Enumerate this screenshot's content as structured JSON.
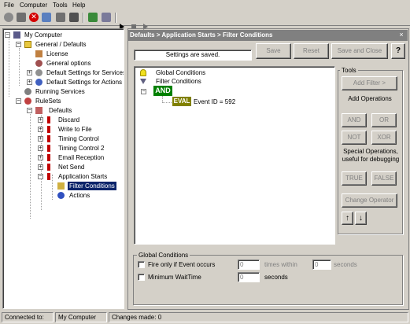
{
  "menu": [
    "File",
    "Computer",
    "Tools",
    "Help"
  ],
  "toolbar": {
    "icons": [
      "settings-gear-icon",
      "save-icon",
      "delete-icon",
      "connect-icon",
      "tools-icon",
      "stop-square-icon",
      "refresh-icon",
      "export-icon",
      "play-icon",
      "stop-icon",
      "step-icon"
    ]
  },
  "tree": {
    "root": "My Computer",
    "general_defaults": "General / Defaults",
    "license": "License",
    "general_options": "General options",
    "default_services": "Default Settings for Services",
    "default_actions": "Default Settings for Actions",
    "running_services": "Running Services",
    "rulesets": "RuleSets",
    "defaults": "Defaults",
    "rules": [
      "Discard",
      "Write to File",
      "Timing Control",
      "Timing Control 2",
      "Email Reception",
      "Net Send",
      "Application Starts"
    ],
    "filter_conditions": "Filter Conditions",
    "actions": "Actions"
  },
  "panel": {
    "breadcrumb": "Defaults > Application Starts > Filter Conditions",
    "close": "×",
    "status_message": "Settings are saved.",
    "save": "Save",
    "reset": "Reset",
    "save_close": "Save and Close",
    "help": "?"
  },
  "filters": {
    "global_conditions": "Global Conditions",
    "filter_conditions": "Filter Conditions",
    "and": "AND",
    "eval": "EVAL",
    "event_id": "Event ID = 592"
  },
  "tools": {
    "title": "Tools",
    "add_filter": "Add Filter >",
    "add_operations": "Add Operations",
    "and": "AND",
    "or": "OR",
    "not": "NOT",
    "xor": "XOR",
    "special_ops": "Special Operations, useful for debugging",
    "true": "TRUE",
    "false": "FALSE",
    "change_operator": "Change Operator",
    "up": "↑",
    "down": "↓"
  },
  "global_conditions": {
    "title": "Global Conditions",
    "fire_only_label": "Fire only if Event occurs",
    "fire_only_value": "0",
    "times_within": "times within",
    "within_value": "0",
    "seconds": "seconds",
    "min_wait_label": "Minimum WaitTime",
    "min_wait_value": "0",
    "seconds2": "seconds"
  },
  "statusbar": {
    "connected_to": "Connected to:",
    "computer": "My Computer",
    "changes": "Changes made: 0"
  },
  "colors": {
    "panel_title_bg": "#808080",
    "and_badge": "#008000",
    "eval_badge": "#808000",
    "selection": "#0a246a"
  }
}
